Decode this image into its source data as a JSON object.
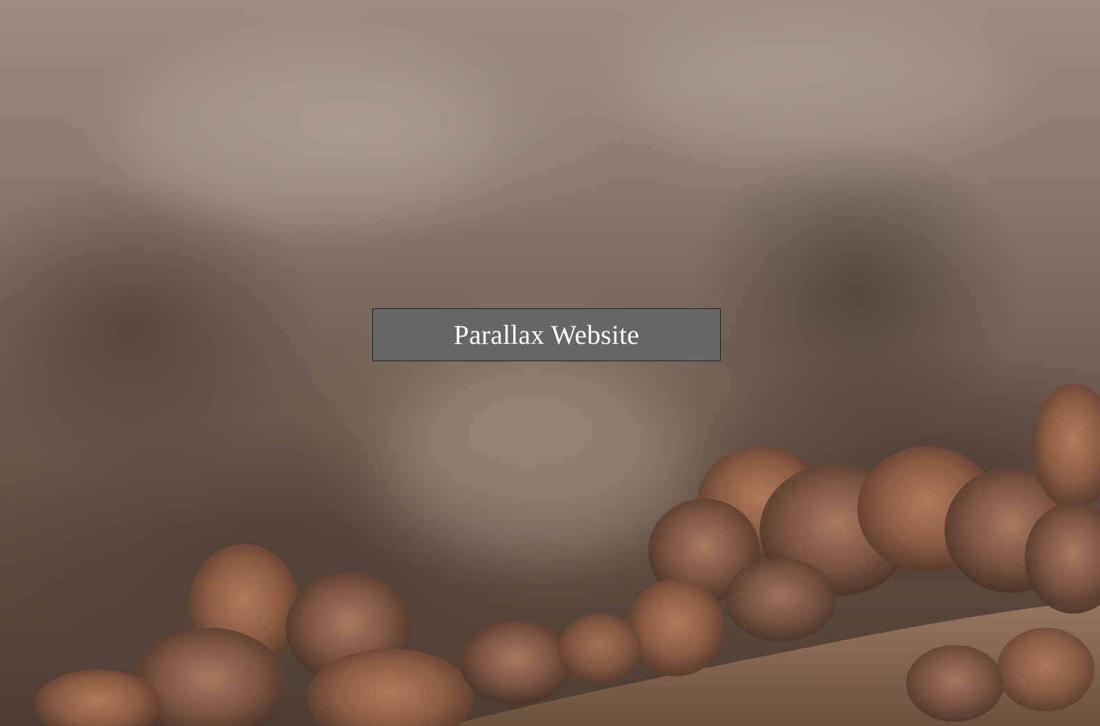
{
  "hero": {
    "title": "Parallax Website",
    "background_image": "foggy-autumn-forest-hillside",
    "title_box_color": "#666666",
    "title_text_color": "#ffffff"
  }
}
